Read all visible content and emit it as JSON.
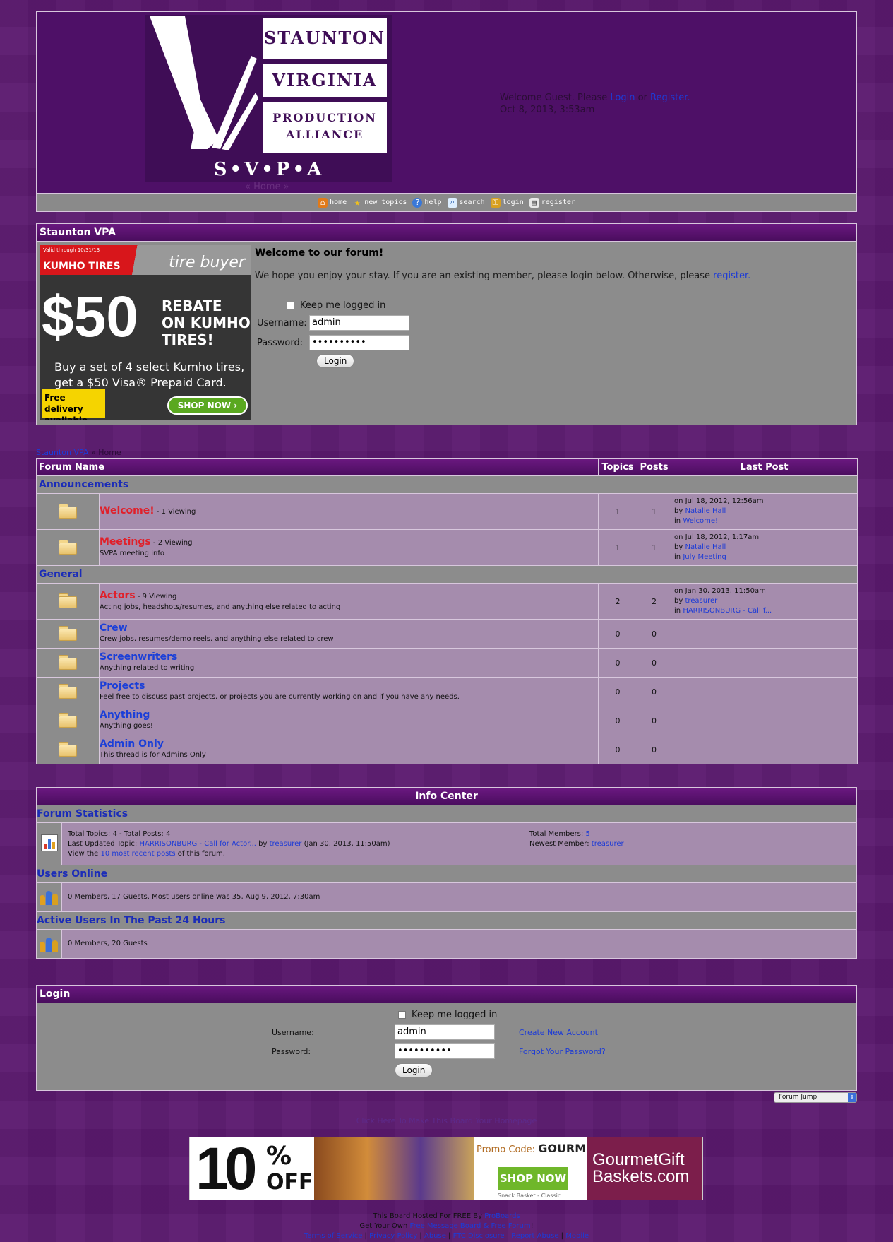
{
  "logo": {
    "line1": "STAUNTON",
    "line2": "VIRGINIA",
    "line3a": "PRODUCTION",
    "line3b": "ALLIANCE",
    "abbr": "S•V•P•A"
  },
  "header": {
    "home_crumb": "« Home »",
    "welcome_prefix": "Welcome Guest. Please",
    "login_link": "Login",
    "or": "or",
    "register_link": "Register.",
    "datetime": "Oct 8, 2013, 3:53am"
  },
  "nav": [
    {
      "label": "home",
      "icon": "home-icon",
      "color": "#e07a1a"
    },
    {
      "label": "new topics",
      "icon": "star-icon",
      "color": "#f2c21a"
    },
    {
      "label": "help",
      "icon": "help-icon",
      "color": "#3a78d8"
    },
    {
      "label": "search",
      "icon": "search-icon",
      "color": "#5aa0e0"
    },
    {
      "label": "login",
      "icon": "login-icon",
      "color": "#d8a020"
    },
    {
      "label": "register",
      "icon": "register-icon",
      "color": "#c8c8c8"
    }
  ],
  "welcome_box": {
    "title": "Staunton VPA",
    "heading": "Welcome to our forum!",
    "text": "We hope you enjoy your stay. If you are an existing member, please login below. Otherwise, please",
    "register_link": "register.",
    "keep_logged": "Keep me logged in",
    "username_label": "Username:",
    "username_value": "admin",
    "password_label": "Password:",
    "password_value": "••••••••••",
    "login_button": "Login"
  },
  "ad_top": {
    "valid": "Valid through 10/31/13",
    "kumho": "KUMHO TIRES",
    "brand": "tire buyer",
    "big": "$50",
    "rebate": "REBATE ON KUMHO TIRES!",
    "copy": "Buy a set of 4 select Kumho tires, get a $50 Visa® Prepaid Card.",
    "free": "Free delivery available",
    "shop": "SHOP NOW"
  },
  "breadcrumb2": {
    "link": "Staunton VPA",
    "sep": "»",
    "current": "Home"
  },
  "forum": {
    "headers": {
      "name": "Forum Name",
      "topics": "Topics",
      "posts": "Posts",
      "last": "Last Post"
    },
    "categories": [
      {
        "name": "Announcements",
        "boards": [
          {
            "name": "Welcome!",
            "viewing": " - 1 Viewing",
            "desc": "",
            "topics": "1",
            "posts": "1",
            "lp_on": "on Jul 18, 2012, 12:56am",
            "lp_by": "Natalie Hall",
            "lp_in": "Welcome!",
            "red": true
          },
          {
            "name": "Meetings",
            "viewing": " - 2 Viewing",
            "desc": "SVPA meeting info",
            "topics": "1",
            "posts": "1",
            "lp_on": "on Jul 18, 2012, 1:17am",
            "lp_by": "Natalie Hall",
            "lp_in": "July Meeting",
            "red": true
          }
        ]
      },
      {
        "name": "General",
        "boards": [
          {
            "name": "Actors",
            "viewing": " - 9 Viewing",
            "desc": "Acting jobs, headshots/resumes, and anything else related to acting",
            "topics": "2",
            "posts": "2",
            "lp_on": "on Jan 30, 2013, 11:50am",
            "lp_by": "treasurer",
            "lp_in": "HARRISONBURG - Call f...",
            "red": true
          },
          {
            "name": "Crew",
            "viewing": "",
            "desc": "Crew jobs, resumes/demo reels, and anything else related to crew",
            "topics": "0",
            "posts": "0",
            "lp_on": "",
            "lp_by": "",
            "lp_in": ""
          },
          {
            "name": "Screenwriters",
            "viewing": "",
            "desc": "Anything related to writing",
            "topics": "0",
            "posts": "0",
            "lp_on": "",
            "lp_by": "",
            "lp_in": ""
          },
          {
            "name": "Projects",
            "viewing": "",
            "desc": "Feel free to discuss past projects, or projects you are currently working on and if you have any needs.",
            "topics": "0",
            "posts": "0",
            "lp_on": "",
            "lp_by": "",
            "lp_in": ""
          },
          {
            "name": "Anything",
            "viewing": "",
            "desc": "Anything goes!",
            "topics": "0",
            "posts": "0",
            "lp_on": "",
            "lp_by": "",
            "lp_in": ""
          },
          {
            "name": "Admin Only",
            "viewing": "",
            "desc": "This thread is for Admins Only",
            "topics": "0",
            "posts": "0",
            "lp_on": "",
            "lp_by": "",
            "lp_in": ""
          }
        ]
      }
    ]
  },
  "info": {
    "title": "Info Center",
    "stats_title": "Forum Statistics",
    "stats_l1": "Total Topics: 4   -   Total Posts: 4",
    "stats_l2_prefix": "Last Updated Topic:",
    "stats_l2_topic": "HARRISONBURG - Call for Actor...",
    "stats_l2_by": "by",
    "stats_l2_user": "treasurer",
    "stats_l2_date": "(Jan 30, 2013, 11:50am)",
    "stats_l3_prefix": "View the",
    "stats_l3_link": "10 most recent posts",
    "stats_l3_suffix": "of this forum.",
    "members_label": "Total Members:",
    "members_value": "5",
    "newest_label": "Newest Member:",
    "newest_value": "treasurer",
    "online_title": "Users Online",
    "online_text": "0 Members, 17 Guests. Most users online was 35, Aug 9, 2012, 7:30am",
    "active_title": "Active Users In The Past 24 Hours",
    "active_text": "0 Members, 20 Guests"
  },
  "login_box": {
    "title": "Login",
    "keep_logged": "Keep me logged in",
    "username_label": "Username:",
    "username_value": "admin",
    "password_label": "Password:",
    "password_value": "••••••••••",
    "create": "Create New Account",
    "forgot": "Forgot Your Password?",
    "button": "Login"
  },
  "forum_jump": "Forum Jump",
  "mid_link": "Click Here To Make This Board Your Homepage",
  "ad_bottom": {
    "pct": "10",
    "pct_sym": "%",
    "off": "OFF",
    "promo_label": "Promo Code:",
    "promo_code": "GOURMET",
    "shop": "SHOP NOW",
    "snack": "Snack Basket - Classic",
    "brand": "GourmetGift Baskets.com"
  },
  "footer": {
    "l1_text": "This Board Hosted For FREE By",
    "l1_link": "ProBoards",
    "l2_text": "Get Your Own",
    "l2_link": "Free Message Board & Free Forum",
    "l2_end": "!",
    "links": [
      "Terms of Service",
      "Privacy Policy",
      "Abuse",
      "FTC Disclosure",
      "Report Abuse",
      "Mobile"
    ]
  }
}
